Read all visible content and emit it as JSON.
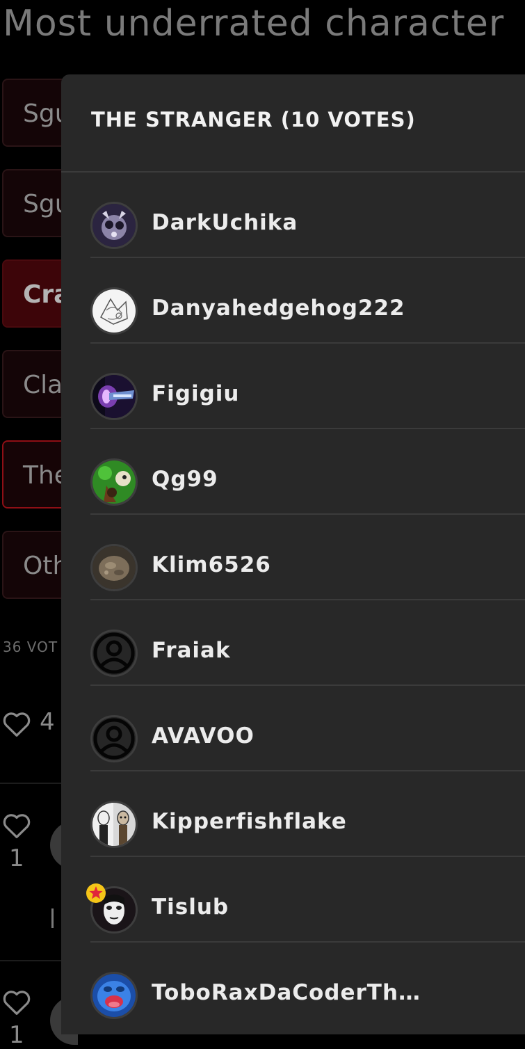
{
  "page": {
    "title": "Most underrated character"
  },
  "poll": {
    "options": [
      {
        "label": "Sgu"
      },
      {
        "label": "Sgu"
      },
      {
        "label": "Cra"
      },
      {
        "label": "Cla"
      },
      {
        "label": "The"
      },
      {
        "label": "Oth"
      }
    ],
    "total_votes": "36 VOT"
  },
  "comments": {
    "likes": [
      "4",
      "1",
      "1"
    ]
  },
  "voters_panel": {
    "title": "THE STRANGER (10 VOTES)",
    "voters": [
      {
        "name": "DarkUchika",
        "avatar": "dark-anime-avatar-icon"
      },
      {
        "name": "Danyahedgehog222",
        "avatar": "sketch-avatar-icon"
      },
      {
        "name": "Figigiu",
        "avatar": "purple-space-avatar-icon"
      },
      {
        "name": "Qg99",
        "avatar": "green-character-avatar-icon"
      },
      {
        "name": "Klim6526",
        "avatar": "rock-avatar-icon"
      },
      {
        "name": "Fraiak",
        "avatar": "default-user-icon"
      },
      {
        "name": "AVAVOO",
        "avatar": "default-user-icon"
      },
      {
        "name": "Kipperfishflake",
        "avatar": "two-characters-avatar-icon"
      },
      {
        "name": "Tislub",
        "avatar": "pale-face-avatar-icon",
        "badge": "star-badge-icon"
      },
      {
        "name": "ToboRaxDaCoderTh…",
        "avatar": "blue-creature-avatar-icon"
      }
    ]
  },
  "colors": {
    "panel_bg": "#282828",
    "accent_red": "#8e0f15",
    "selected_bg": "#3d0509",
    "badge_gold": "#f5c518"
  }
}
